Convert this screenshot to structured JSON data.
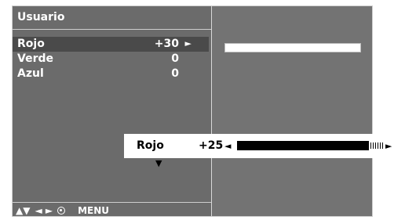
{
  "menu": {
    "title": "Usuario",
    "items": [
      {
        "label": "Rojo",
        "value": "+30",
        "arrow": "►"
      },
      {
        "label": "Verde",
        "value": "0"
      },
      {
        "label": "Azul",
        "value": "0"
      }
    ]
  },
  "nav": {
    "updown": "▲▼",
    "leftright": "◄ ►",
    "menu_label": "MENU"
  },
  "popup": {
    "label": "Rojo",
    "value": "+25",
    "left_arrow": "◄",
    "right_arrow": "►",
    "level_fraction": 0.9,
    "down_arrow": "▼"
  },
  "colors": {
    "panel": "#6b6b6b",
    "selected_row": "#4a4a4a",
    "popup_bg": "#ffffff"
  }
}
